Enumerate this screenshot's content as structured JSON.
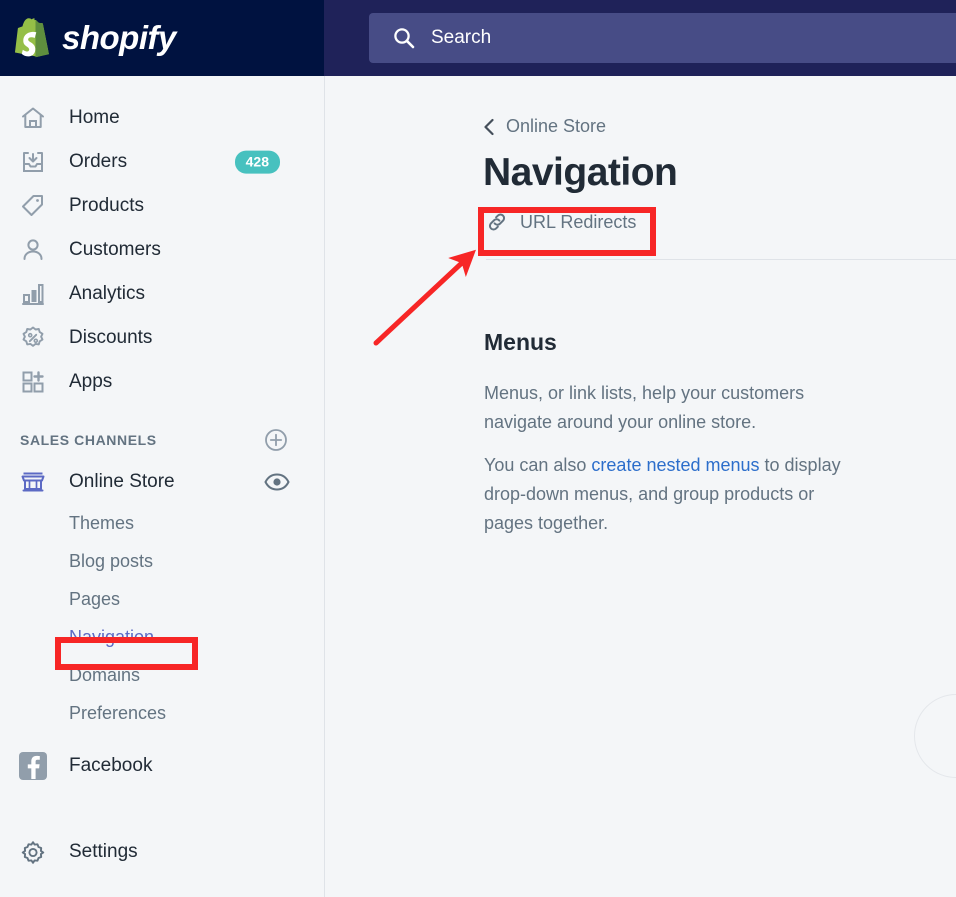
{
  "brand": {
    "name": "shopify",
    "logo_icon": "shopify-bag-icon",
    "accent_purple": "#5C6AC4",
    "accent_teal": "#47C1BF",
    "link_blue": "#2C6ECB",
    "annotation_red": "#F72626",
    "nav_dark": "#1F2259",
    "logo_dark": "#001240"
  },
  "search": {
    "placeholder": "Search",
    "value": "",
    "icon": "search-icon"
  },
  "sidebar": {
    "items": [
      {
        "label": "Home",
        "icon": "home-icon",
        "badge": ""
      },
      {
        "label": "Orders",
        "icon": "orders-inbox-icon",
        "badge": "428"
      },
      {
        "label": "Products",
        "icon": "tag-icon",
        "badge": ""
      },
      {
        "label": "Customers",
        "icon": "person-icon",
        "badge": ""
      },
      {
        "label": "Analytics",
        "icon": "bar-chart-icon",
        "badge": ""
      },
      {
        "label": "Discounts",
        "icon": "discount-percent-icon",
        "badge": ""
      },
      {
        "label": "Apps",
        "icon": "apps-grid-plus-icon",
        "badge": ""
      }
    ],
    "section": {
      "title": "SALES CHANNELS",
      "add_icon": "plus-circle-icon"
    },
    "channel": {
      "label": "Online Store",
      "icon": "storefront-icon",
      "view_icon": "eye-icon"
    },
    "sub_items": [
      {
        "label": "Themes",
        "active": false
      },
      {
        "label": "Blog posts",
        "active": false
      },
      {
        "label": "Pages",
        "active": false
      },
      {
        "label": "Navigation",
        "active": true
      },
      {
        "label": "Domains",
        "active": false
      },
      {
        "label": "Preferences",
        "active": false
      }
    ],
    "facebook": {
      "label": "Facebook",
      "icon": "facebook-icon"
    },
    "settings": {
      "label": "Settings",
      "icon": "gear-icon"
    }
  },
  "main": {
    "breadcrumb": {
      "label": "Online Store",
      "icon": "chevron-left-icon"
    },
    "page_title": "Navigation",
    "url_redirects": {
      "label": "URL Redirects",
      "icon": "link-chain-icon"
    },
    "menus": {
      "heading": "Menus",
      "paragraph1": "Menus, or link lists, help your customers navigate around your online store.",
      "paragraph2_before": "You can also ",
      "paragraph2_link": "create nested menus",
      "paragraph2_after": " to display drop-down menus, and group products or pages together."
    }
  },
  "annotations": {
    "highlight_navigation": "Navigation",
    "highlight_url_redirects": "URL Redirects",
    "arrow": "red-arrow-pointing-to-url-redirects"
  }
}
